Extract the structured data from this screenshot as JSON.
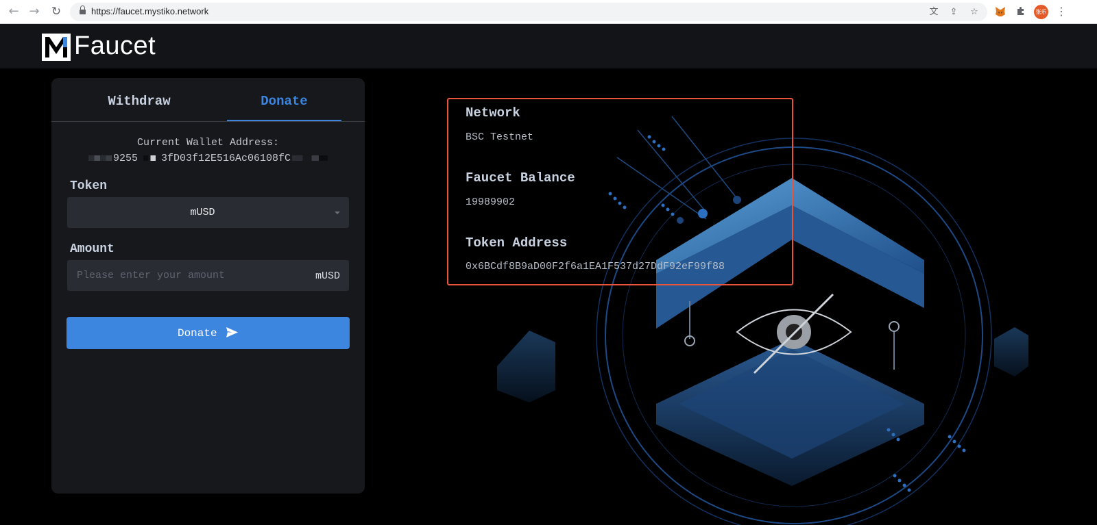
{
  "browser": {
    "url": "https://faucet.mystiko.network",
    "profile_initials": "张乐"
  },
  "header": {
    "logo_text": "Faucet"
  },
  "tabs": [
    {
      "label": "Withdraw",
      "active": false
    },
    {
      "label": "Donate",
      "active": true
    }
  ],
  "wallet": {
    "label": "Current Wallet Address:",
    "address_part1": "9255",
    "address_part2": "3fD03f12E516Ac06108fC"
  },
  "form": {
    "token_label": "Token",
    "token_value": "mUSD",
    "amount_label": "Amount",
    "amount_placeholder": "Please enter your amount",
    "amount_unit": "mUSD",
    "submit_label": "Donate"
  },
  "info": {
    "network_label": "Network",
    "network_value": "BSC Testnet",
    "balance_label": "Faucet Balance",
    "balance_value": "19989902",
    "token_address_label": "Token Address",
    "token_address_value": "0x6BCdf8B9aD00F2f6a1EA1F537d27DdF92eF99f88"
  },
  "colors": {
    "accent": "#3d86e0",
    "highlight_border": "#e8553a",
    "card_bg": "#17181c",
    "header_bg": "#121418"
  },
  "icons": [
    "back-arrow-icon",
    "forward-arrow-icon",
    "reload-icon",
    "lock-icon",
    "translate-icon",
    "share-icon",
    "star-icon",
    "metamask-fox-icon",
    "puzzle-extension-icon",
    "more-menu-icon",
    "caret-down-icon",
    "send-icon"
  ]
}
